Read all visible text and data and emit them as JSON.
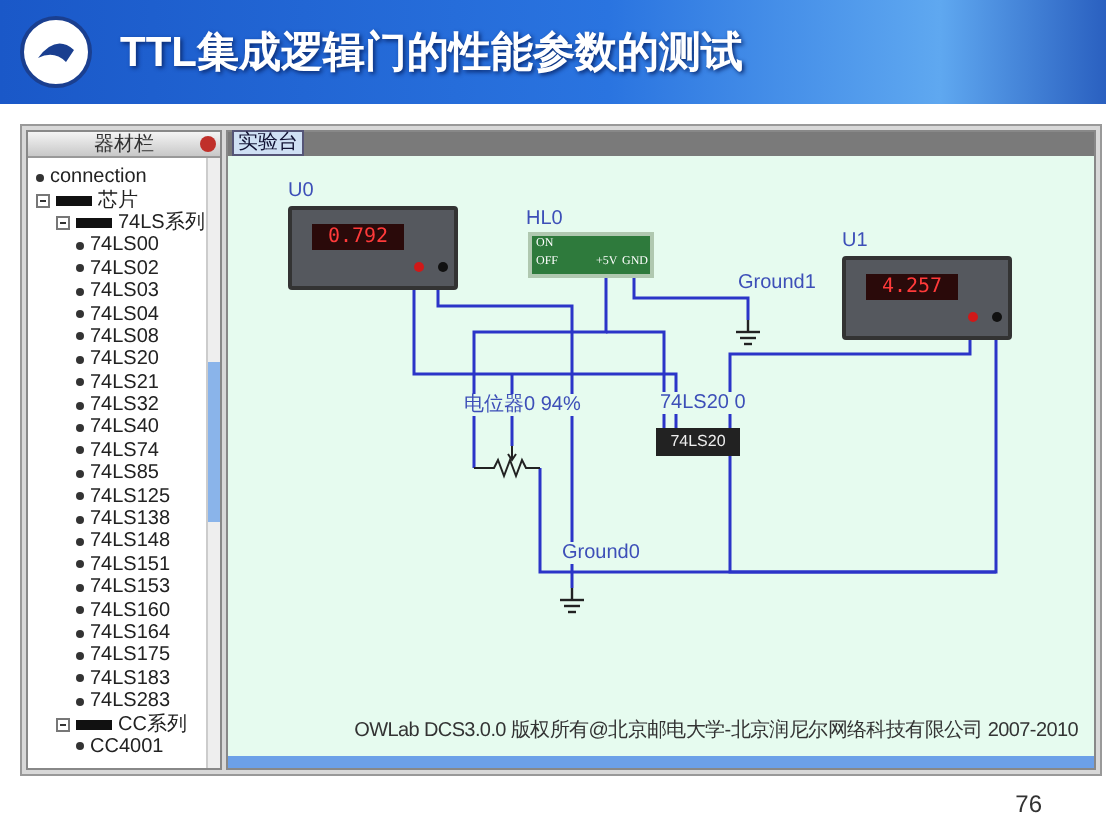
{
  "banner": {
    "title": "TTL集成逻辑门的性能参数的测试"
  },
  "sidebar": {
    "header": "器材栏",
    "tree": [
      {
        "label": "connection"
      },
      {
        "label": "芯片",
        "expanded": true,
        "children": [
          {
            "label": "74LS系列",
            "expanded": true,
            "children": [
              {
                "label": "74LS00"
              },
              {
                "label": "74LS02"
              },
              {
                "label": "74LS03"
              },
              {
                "label": "74LS04"
              },
              {
                "label": "74LS08"
              },
              {
                "label": "74LS20"
              },
              {
                "label": "74LS21"
              },
              {
                "label": "74LS32"
              },
              {
                "label": "74LS40"
              },
              {
                "label": "74LS74"
              },
              {
                "label": "74LS85"
              },
              {
                "label": "74LS125"
              },
              {
                "label": "74LS138"
              },
              {
                "label": "74LS148"
              },
              {
                "label": "74LS151"
              },
              {
                "label": "74LS153"
              },
              {
                "label": "74LS160"
              },
              {
                "label": "74LS164"
              },
              {
                "label": "74LS175"
              },
              {
                "label": "74LS183"
              },
              {
                "label": "74LS283"
              }
            ]
          },
          {
            "label": "CC系列",
            "expanded": true,
            "children": [
              {
                "label": "CC4001"
              }
            ]
          }
        ]
      }
    ]
  },
  "workspace": {
    "tab": {
      "label": "实验台",
      "selected": true
    },
    "components": [
      {
        "kind": "meter",
        "name": "U0",
        "reading": "0.792"
      },
      {
        "kind": "switch",
        "name": "HL0",
        "on_label": "ON",
        "off_label": "OFF",
        "terminals": [
          "+5V",
          "GND"
        ]
      },
      {
        "kind": "ground",
        "name": "Ground1"
      },
      {
        "kind": "meter",
        "name": "U1",
        "reading": "4.257"
      },
      {
        "kind": "potentiometer",
        "name": "电位器0  94%"
      },
      {
        "kind": "chip",
        "name": "74LS20 0",
        "part": "74LS20"
      },
      {
        "kind": "ground",
        "name": "Ground0"
      }
    ],
    "footer": "OWLab DCS3.0.0 版权所有@北京邮电大学-北京润尼尔网络科技有限公司 2007-2010"
  },
  "page_number": "76"
}
